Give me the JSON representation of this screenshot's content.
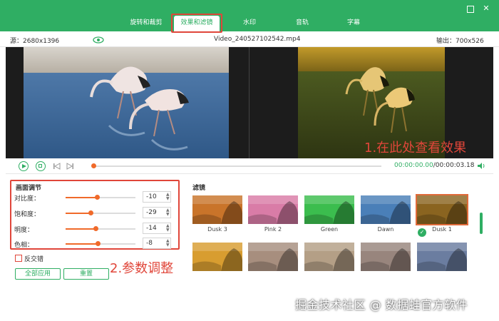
{
  "tabs": [
    {
      "label": "旋转和裁剪"
    },
    {
      "label": "效果和滤镜"
    },
    {
      "label": "水印"
    },
    {
      "label": "音轨"
    },
    {
      "label": "字幕"
    }
  ],
  "window": {
    "maximize_glyph": "",
    "close_glyph": "✕"
  },
  "infobar": {
    "source": "源：2680x1396",
    "filename": "Video_240527102542.mp4",
    "output": "输出：700x526"
  },
  "annotations": {
    "preview_note": "1.在此处查看效果",
    "params_note": "2.参数调整"
  },
  "player": {
    "current_time": "00:00:00.00",
    "total_time": "/00:00:03.18"
  },
  "adjust": {
    "title": "画面调节",
    "rows": [
      {
        "label": "对比度：",
        "value": "-10",
        "level": 0.45
      },
      {
        "label": "饱和度：",
        "value": "-29",
        "level": 0.36
      },
      {
        "label": "明度：",
        "value": "-14",
        "level": 0.43
      },
      {
        "label": "色相：",
        "value": "-8",
        "level": 0.46
      }
    ],
    "reverse_label": "反交错",
    "apply_all": "全部应用",
    "reset": "重置"
  },
  "filters": {
    "title": "滤镜",
    "row1": [
      {
        "name": "Dusk 3",
        "tint": "#c9742a"
      },
      {
        "name": "Pink 2",
        "tint": "#d97ca7"
      },
      {
        "name": "Green",
        "tint": "#3bbd4e"
      },
      {
        "name": "Dawn",
        "tint": "#4a7fb8"
      },
      {
        "name": "Dusk 1",
        "tint": "#8a6420",
        "selected": true
      }
    ],
    "row2": [
      {
        "tint": "#d89d30"
      },
      {
        "tint": "#a78e7e"
      },
      {
        "tint": "#b49f86"
      },
      {
        "tint": "#98857d"
      },
      {
        "tint": "#6b7da0"
      }
    ]
  },
  "watermark": "掘金技术社区 @ 数据蛙官方软件",
  "colors": {
    "brand": "#2fae63",
    "accent": "#f06a2a",
    "annotation": "#e0463a"
  }
}
